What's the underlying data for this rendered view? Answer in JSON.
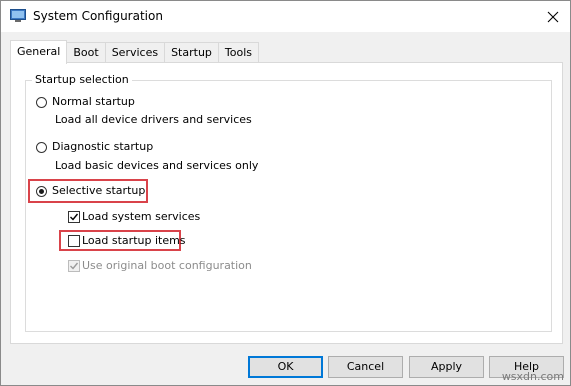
{
  "window": {
    "title": "System Configuration"
  },
  "tabs": [
    {
      "label": "General",
      "active": true
    },
    {
      "label": "Boot",
      "active": false
    },
    {
      "label": "Services",
      "active": false
    },
    {
      "label": "Startup",
      "active": false
    },
    {
      "label": "Tools",
      "active": false
    }
  ],
  "startup_selection": {
    "group_label": "Startup selection",
    "normal": {
      "label": "Normal startup",
      "description": "Load all device drivers and services",
      "selected": false
    },
    "diagnostic": {
      "label": "Diagnostic startup",
      "description": "Load basic devices and services only",
      "selected": false
    },
    "selective": {
      "label": "Selective startup",
      "selected": true
    },
    "options": {
      "load_system_services": {
        "label": "Load system services",
        "checked": true,
        "enabled": true
      },
      "load_startup_items": {
        "label": "Load startup items",
        "checked": false,
        "enabled": true
      },
      "use_original_boot": {
        "label": "Use original boot configuration",
        "checked": true,
        "enabled": false
      }
    }
  },
  "buttons": {
    "ok": "OK",
    "cancel": "Cancel",
    "apply": "Apply",
    "help": "Help"
  },
  "watermark": "wsxdn.com",
  "colors": {
    "highlight": "#d9434a",
    "default_button_border": "#0078d7"
  }
}
